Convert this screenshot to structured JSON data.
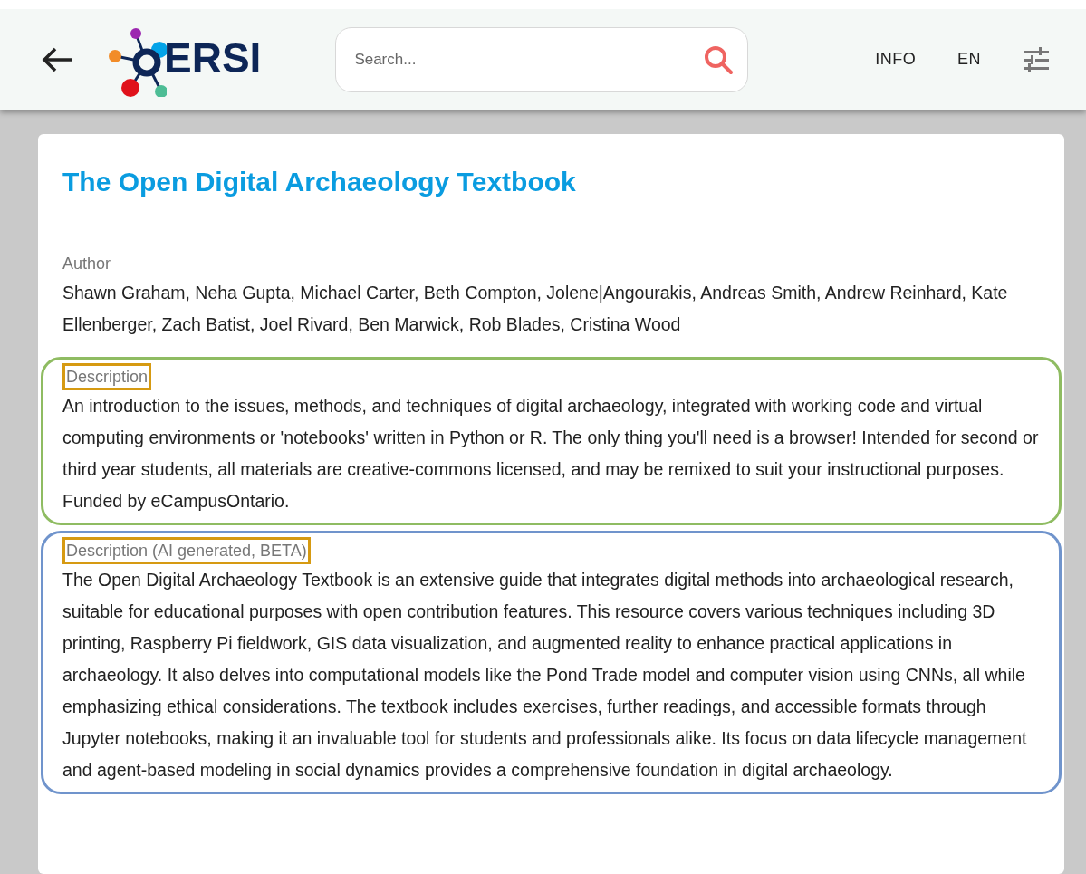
{
  "header": {
    "logo_text": "ERSI",
    "search": {
      "placeholder": "Search..."
    },
    "nav": [
      "INFO",
      "EN"
    ]
  },
  "record": {
    "title": "The Open Digital Archaeology Textbook",
    "sections": [
      {
        "kind": "plain",
        "label": "Author",
        "text": "Shawn Graham, Neha Gupta, Michael Carter, Beth Compton, Jolene|Angourakis, Andreas Smith, Andrew Reinhard, Kate Ellenberger, Zach Batist, Joel Rivard, Ben Marwick, Rob Blades, Cristina Wood"
      },
      {
        "kind": "framed",
        "color": "#8fbc62",
        "label": "Description",
        "text": "An introduction to the issues, methods, and techniques of digital archaeology, integrated with working code and virtual computing environments or 'notebooks' written in Python or R. The only thing you'll need is a browser! Intended for second or third year students, all materials are creative-commons licensed, and may be remixed to suit your instructional purposes. Funded by eCampusOntario."
      },
      {
        "kind": "framed",
        "color": "#7094cc",
        "label": "Description (AI generated, BETA)",
        "text": "The Open Digital Archaeology Textbook is an extensive guide that integrates digital methods into archaeological research, suitable for educational purposes with open contribution features. This resource covers various techniques including 3D printing, Raspberry Pi fieldwork, GIS data visualization, and augmented reality to enhance practical applications in archaeology. It also delves into computational models like the Pond Trade model and computer vision using CNNs, all while emphasizing ethical considerations. The textbook includes exercises, further readings, and accessible formats through Jupyter notebooks, making it an invaluable tool for students and professionals alike. Its focus on data lifecycle management and agent-based modeling in social dynamics provides a comprehensive foundation in digital archaeology."
      }
    ]
  }
}
